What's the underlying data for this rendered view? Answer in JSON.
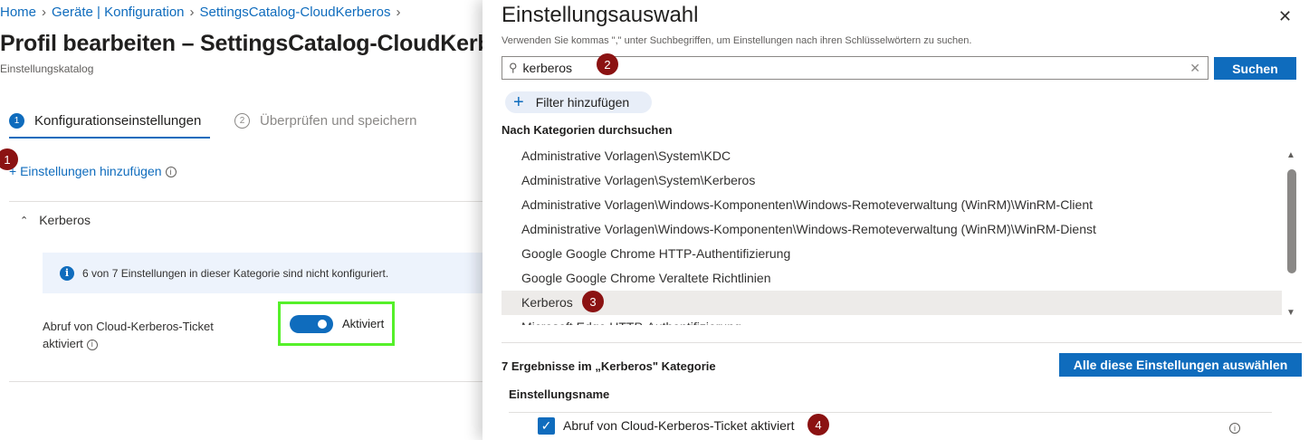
{
  "breadcrumb": [
    "Home",
    "Geräte | Konfiguration",
    "SettingsCatalog-CloudKerberos",
    ""
  ],
  "page": {
    "title": "Profil bearbeiten – SettingsCatalog-CloudKerberos",
    "subtitle": "Einstellungskatalog"
  },
  "steps": [
    {
      "num": "1",
      "label": "Konfigurationseinstellungen",
      "active": true
    },
    {
      "num": "2",
      "label": "Überprüfen und speichern",
      "active": false
    }
  ],
  "add_settings_link": "+ Einstellungen hinzufügen",
  "section": {
    "name": "Kerberos",
    "info": "6 von 7 Einstellungen in dieser Kategorie sind nicht konfiguriert.",
    "setting_label": "Abruf von Cloud-Kerberos-Ticket aktiviert",
    "toggle_state": "Aktiviert"
  },
  "panel": {
    "title": "Einstellungsauswahl",
    "description": "Verwenden Sie kommas \",\" unter Suchbegriffen, um Einstellungen nach ihren Schlüsselwörtern zu suchen.",
    "search_value": "kerberos",
    "search_button": "Suchen",
    "filter_button": "Filter hinzufügen",
    "browse_heading": "Nach Kategorien durchsuchen",
    "categories": [
      "Administrative Vorlagen\\System\\KDC",
      "Administrative Vorlagen\\System\\Kerberos",
      "Administrative Vorlagen\\Windows-Komponenten\\Windows-Remoteverwaltung (WinRM)\\WinRM-Client",
      "Administrative Vorlagen\\Windows-Komponenten\\Windows-Remoteverwaltung (WinRM)\\WinRM-Dienst",
      "Google Google Chrome HTTP-Authentifizierung",
      "Google Google Chrome Veraltete Richtlinien",
      "Kerberos",
      "Microsoft Edge HTTP-Authentifizierung"
    ],
    "selected_category_index": 6,
    "results_heading": "7 Ergebnisse im „Kerberos\" Kategorie",
    "select_all_button": "Alle diese Einstellungen auswählen",
    "column_header": "Einstellungsname",
    "result_item": "Abruf von Cloud-Kerberos-Ticket aktiviert"
  },
  "markers": [
    "1",
    "2",
    "3",
    "4"
  ],
  "icons": {
    "close": "close-icon",
    "search": "search-icon",
    "clear": "clear-icon",
    "info": "info-icon",
    "add": "plus-icon"
  },
  "colors": {
    "accent": "#0f6cbd",
    "marker": "#8b1212",
    "highlight_box": "#55f02a"
  }
}
